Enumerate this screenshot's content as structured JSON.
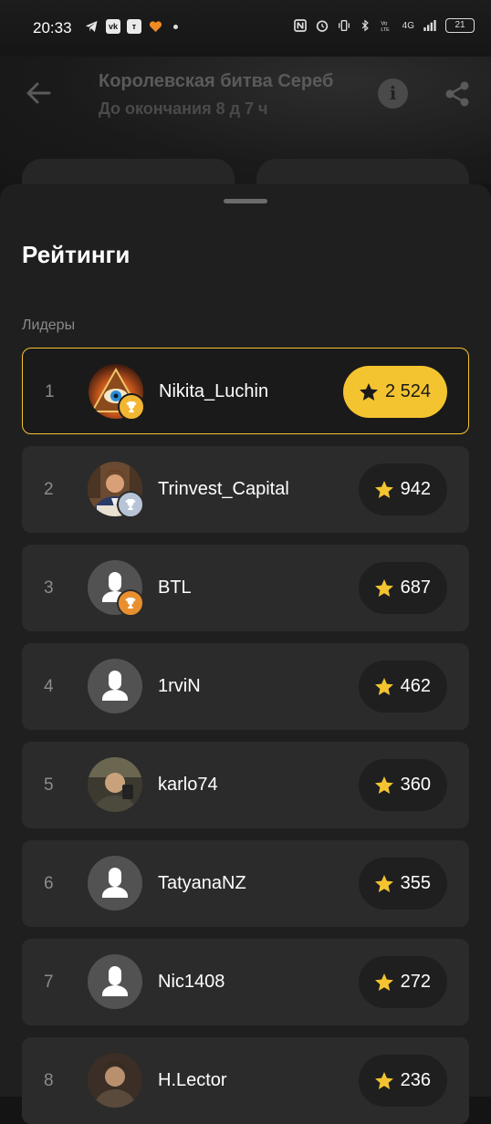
{
  "status": {
    "time": "20:33",
    "battery": "21",
    "network": "4G"
  },
  "header": {
    "title": "Королевская битва Сереб",
    "subtitle": "До окончания 8 д 7 ч"
  },
  "sheet": {
    "title": "Рейтинги",
    "section_label": "Лидеры"
  },
  "colors": {
    "accent": "#f4c430",
    "gold_trophy": "#f2b632",
    "silver_trophy": "#b7c4d6",
    "bronze_trophy": "#e8902e",
    "background": "#1f1f1f",
    "row": "#2b2b2b"
  },
  "leaders": [
    {
      "rank": "1",
      "name": "Nikita_Luchin",
      "score": "2 524",
      "avatar": "eye-pyramid",
      "trophy": "gold"
    },
    {
      "rank": "2",
      "name": "Trinvest_Capital",
      "score": "942",
      "avatar": "man-in-suit",
      "trophy": "silver"
    },
    {
      "rank": "3",
      "name": "BTL",
      "score": "687",
      "avatar": "default",
      "trophy": "bronze"
    },
    {
      "rank": "4",
      "name": "1rviN",
      "score": "462",
      "avatar": "default",
      "trophy": ""
    },
    {
      "rank": "5",
      "name": "karlo74",
      "score": "360",
      "avatar": "photo",
      "trophy": ""
    },
    {
      "rank": "6",
      "name": "TatyanaNZ",
      "score": "355",
      "avatar": "default",
      "trophy": ""
    },
    {
      "rank": "7",
      "name": "Nic1408",
      "score": "272",
      "avatar": "default",
      "trophy": ""
    },
    {
      "rank": "8",
      "name": "H.Lector",
      "score": "236",
      "avatar": "photo",
      "trophy": ""
    }
  ]
}
